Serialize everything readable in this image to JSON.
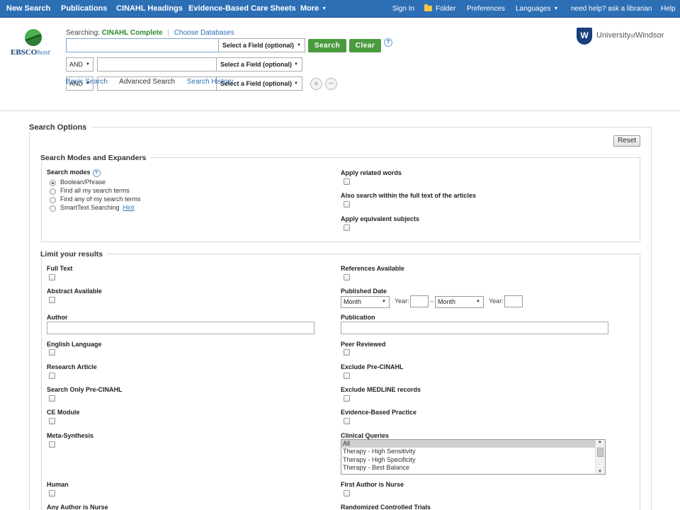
{
  "topnav": {
    "left": [
      "New Search",
      "Publications",
      "CINAHL Headings",
      "Evidence-Based Care Sheets",
      "More"
    ],
    "right": {
      "sign_in": "Sign In",
      "folder": "Folder",
      "preferences": "Preferences",
      "languages": "Languages",
      "help_librarian": "need help? ask a librarian",
      "help": "Help"
    }
  },
  "logo": {
    "main": "EBSCO",
    "suffix": "host"
  },
  "searching": {
    "prefix": "Searching:",
    "database": "CINAHL Complete",
    "choose": "Choose Databases"
  },
  "search_rows": {
    "field_placeholder": "Select a Field (optional)",
    "bool_op": "AND",
    "search_btn": "Search",
    "clear_btn": "Clear",
    "help": "?",
    "add": "+",
    "remove": "−"
  },
  "tabs": {
    "basic": "Basic Search",
    "advanced": "Advanced Search",
    "history": "Search History"
  },
  "institution": {
    "name_a": "University",
    "name_of": "of",
    "name_b": "Windsor",
    "mark": "W"
  },
  "search_options": {
    "title": "Search Options",
    "reset": "Reset",
    "modes_title": "Search Modes and Expanders",
    "modes_label": "Search modes",
    "modes": [
      "Boolean/Phrase",
      "Find all my search terms",
      "Find any of my search terms",
      "SmartText Searching"
    ],
    "hint": "Hint",
    "expanders": [
      "Apply related words",
      "Also search within the full text of the articles",
      "Apply equivalent subjects"
    ]
  },
  "limits": {
    "title": "Limit your results",
    "full_text": "Full Text",
    "references": "References Available",
    "abstract": "Abstract Available",
    "published_date": "Published Date",
    "month": "Month",
    "year": "Year:",
    "dash": "–",
    "author": "Author",
    "publication": "Publication",
    "english": "English Language",
    "peer": "Peer Reviewed",
    "research": "Research Article",
    "exclude_pre": "Exclude Pre-CINAHL",
    "search_only_pre": "Search Only Pre-CINAHL",
    "exclude_medline": "Exclude MEDLINE records",
    "ce_module": "CE Module",
    "ebp": "Evidence-Based Practice",
    "meta": "Meta-Synthesis",
    "clinical_queries": "Clinical Queries",
    "clinical_options": [
      "All",
      "Therapy - High Sensitivity",
      "Therapy - High Specificity",
      "Therapy - Best Balance"
    ],
    "human": "Human",
    "first_author_nurse": "First Author is Nurse",
    "any_author_nurse": "Any Author is Nurse",
    "rct": "Randomized Controlled Trials"
  }
}
